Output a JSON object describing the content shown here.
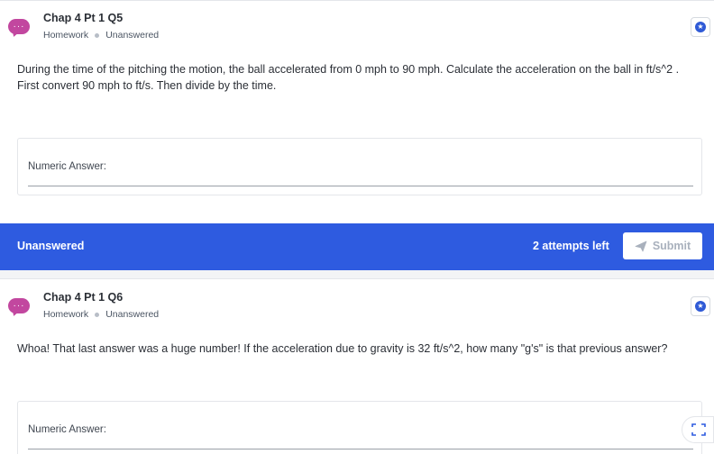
{
  "question_a": {
    "title": "Chap 4 Pt 1 Q5",
    "type": "Homework",
    "status": "Unanswered",
    "text": "During the time of the pitching the motion, the ball accelerated from 0 mph to 90 mph. Calculate the acceleration on the ball in ft/s^2 . First convert 90 mph to ft/s. Then divide by the time.",
    "answer_label": "Numeric Answer:",
    "answer_value": ""
  },
  "status_bar": {
    "status": "Unanswered",
    "attempts": "2 attempts left",
    "submit_label": "Submit"
  },
  "question_b": {
    "title": "Chap 4 Pt 1 Q6",
    "type": "Homework",
    "status": "Unanswered",
    "text": "Whoa! That last answer was a huge number! If the acceleration due to gravity is 32 ft/s^2, how many \"g's\" is that previous answer?",
    "answer_label": "Numeric Answer:",
    "answer_value": ""
  },
  "avatar_glyph": "···",
  "star_glyph": "★",
  "icons": {
    "avatar": "chat-bubble-icon",
    "bookmark": "star-icon",
    "submit": "send-icon",
    "expand": "expand-icon"
  },
  "colors": {
    "avatar": "#c2479f",
    "status_bar": "#2e5be0",
    "bookmark": "#2f5ad6",
    "submit_disabled_text": "#a9b1bd"
  }
}
